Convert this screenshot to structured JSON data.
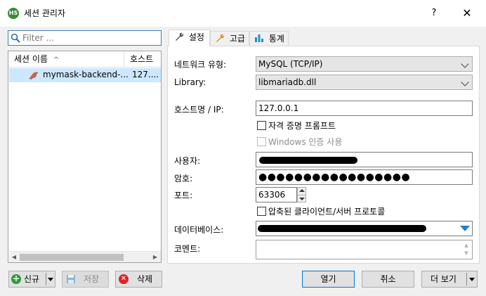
{
  "window": {
    "title": "세션 관리자",
    "app_icon_text": "HS",
    "help": "?",
    "close": "✕"
  },
  "filter": {
    "placeholder": "Filter ..."
  },
  "tree": {
    "col_name": "세션 이름",
    "col_host": "호스트",
    "sort_indicator": "^",
    "session": {
      "name": "mymask-backend-...",
      "host": "127...."
    }
  },
  "bottom": {
    "new": "신규",
    "save": "저장",
    "delete": "삭제",
    "open": "열기",
    "cancel": "취소",
    "more": "더 보기"
  },
  "tabs": [
    {
      "label": "설정"
    },
    {
      "label": "고급"
    },
    {
      "label": "통계"
    }
  ],
  "settings": {
    "network_type_label": "네트워크 유형:",
    "network_type_value": "MySQL (TCP/IP)",
    "library_label": "Library:",
    "library_value": "libmariadb.dll",
    "host_label": "호스트명 / IP:",
    "host_value": "127.0.0.1",
    "prompt_credentials": "자격 증명 프롬프트",
    "windows_auth": "Windows 인증 사용",
    "user_label": "사용자:",
    "password_label": "암호:",
    "password_mask": "●●●●●●●●●●●●●●●●●",
    "port_label": "포트:",
    "port_value": "63306",
    "compressed": "압축된 클라이언트/서버 프로토콜",
    "database_label": "데이터베이스:",
    "comment_label": "코멘트:"
  },
  "colors": {
    "accent": "#0078d7",
    "selection": "#cce8ff"
  }
}
